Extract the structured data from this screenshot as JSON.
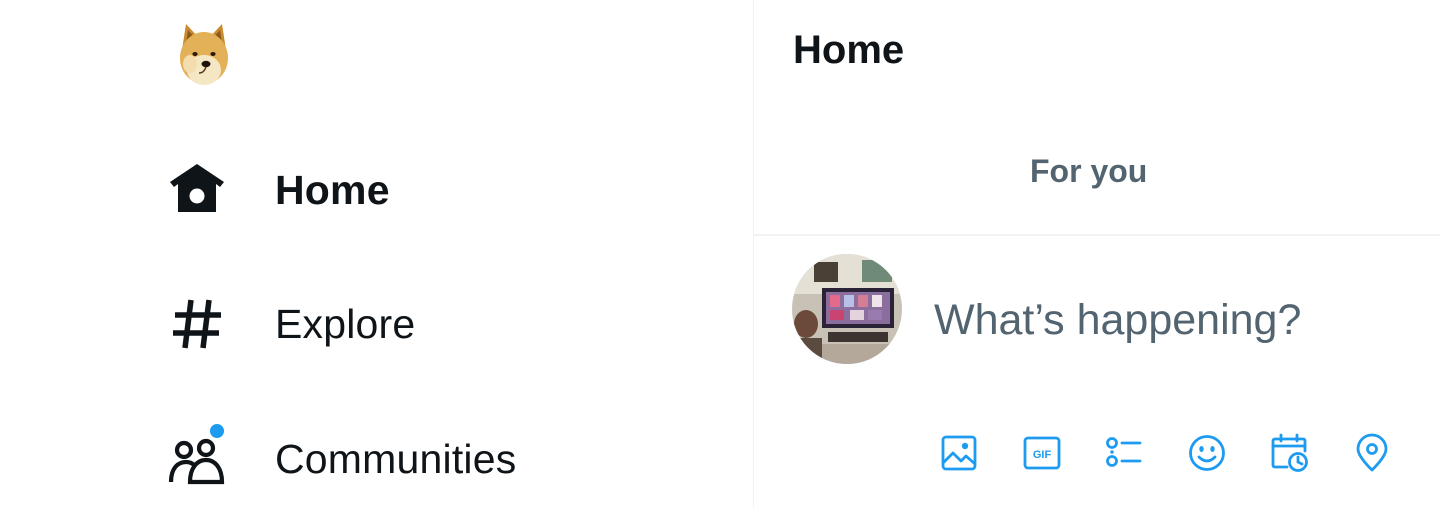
{
  "sidebar": {
    "logo_icon": "doge-logo-icon",
    "items": [
      {
        "label": "Home",
        "icon": "home-icon",
        "active": true
      },
      {
        "label": "Explore",
        "icon": "hashtag-icon",
        "active": false
      },
      {
        "label": "Communities",
        "icon": "communities-icon",
        "active": false,
        "has_notification": true
      }
    ]
  },
  "header": {
    "title": "Home"
  },
  "tabs": [
    {
      "label": "For you"
    }
  ],
  "composer": {
    "placeholder": "What’s happening?",
    "toolbar_icons": [
      "image-icon",
      "gif-icon",
      "poll-icon",
      "emoji-icon",
      "schedule-icon",
      "location-icon"
    ]
  },
  "colors": {
    "accent": "#1d9bf0",
    "text": "#0f1419",
    "muted": "#536471",
    "divider": "#eff3f4"
  }
}
